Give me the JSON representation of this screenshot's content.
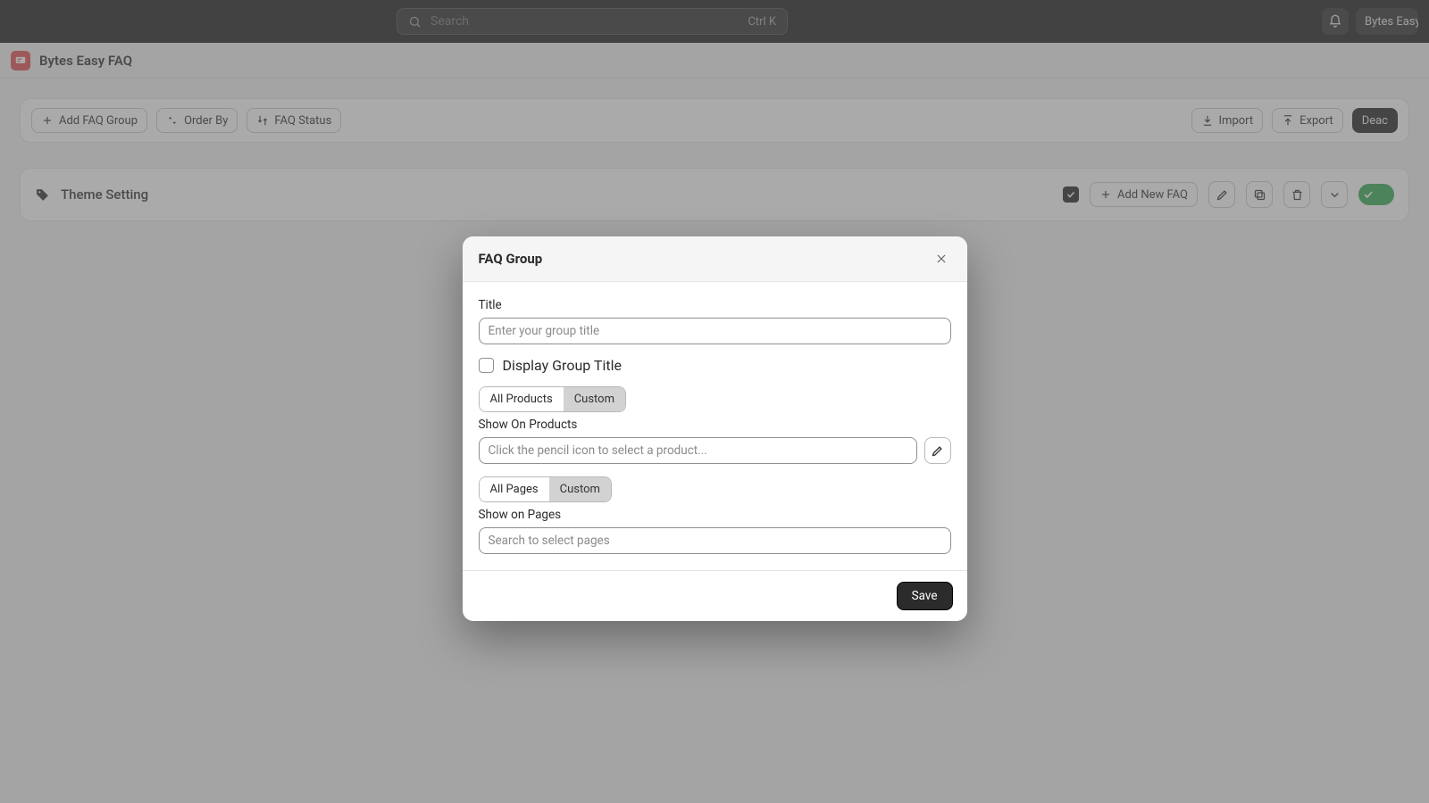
{
  "topbar": {
    "search_placeholder": "Search",
    "kbd": "Ctrl K",
    "account_label": "Bytes Easy"
  },
  "appbar": {
    "title": "Bytes Easy FAQ"
  },
  "toolbar": {
    "add_group": "Add FAQ Group",
    "order_by": "Order By",
    "faq_status": "FAQ Status",
    "import": "Import",
    "export": "Export",
    "deactivate": "Deac"
  },
  "group": {
    "title": "Theme Setting",
    "add_new": "Add New FAQ"
  },
  "modal": {
    "title": "FAQ Group",
    "field_title_label": "Title",
    "field_title_placeholder": "Enter your group title",
    "display_group_title": "Display Group Title",
    "seg_products_all": "All Products",
    "seg_products_custom": "Custom",
    "show_on_products": "Show On Products",
    "products_placeholder": "Click the pencil icon to select a product...",
    "seg_pages_all": "All Pages",
    "seg_pages_custom": "Custom",
    "show_on_pages": "Show on Pages",
    "pages_placeholder": "Search to select pages",
    "save": "Save"
  }
}
